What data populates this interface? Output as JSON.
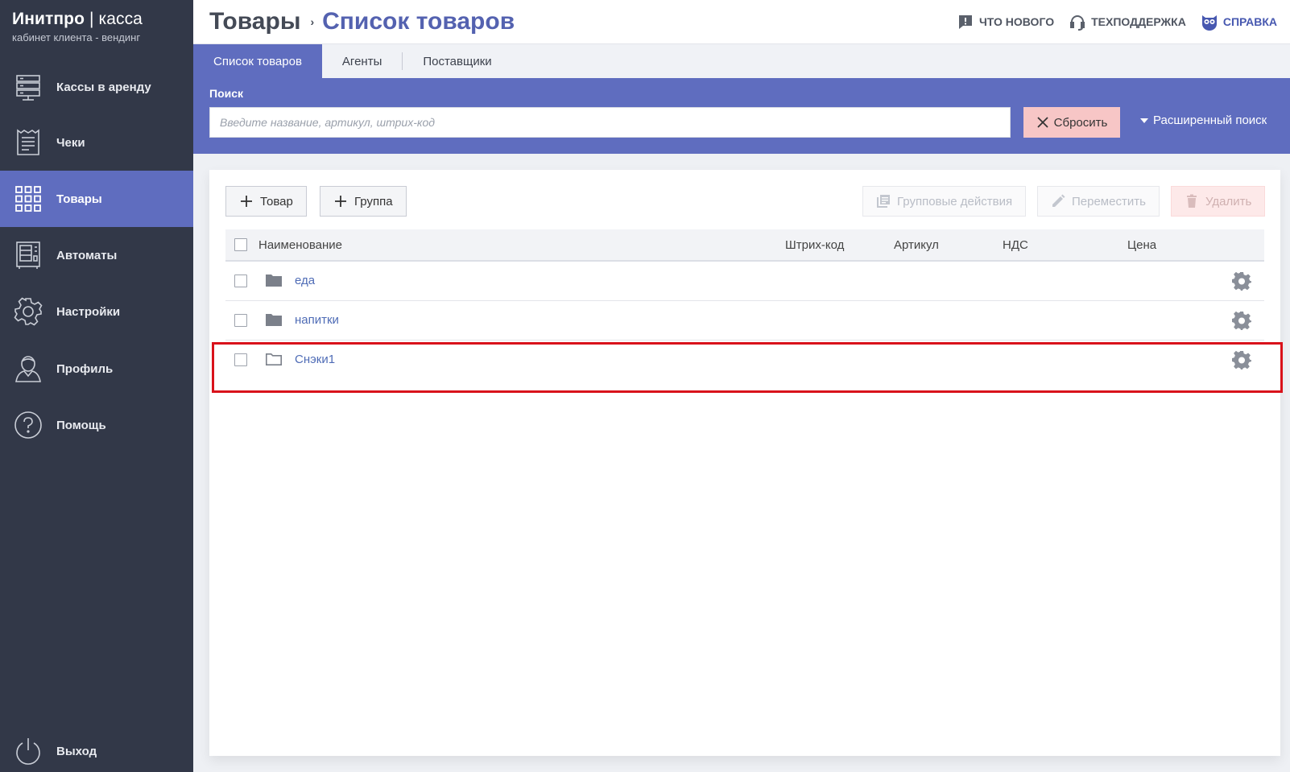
{
  "brand": {
    "name_bold": "Инитпро",
    "name_sep": " | ",
    "name_thin": "касса",
    "subtitle": "кабинет клиента - вендинг"
  },
  "sidebar": {
    "items": [
      {
        "label": "Кассы в аренду",
        "icon": "server-rack-icon",
        "active": false
      },
      {
        "label": "Чеки",
        "icon": "receipt-icon",
        "active": false
      },
      {
        "label": "Товары",
        "icon": "grid-icon",
        "active": true
      },
      {
        "label": "Автоматы",
        "icon": "vending-machine-icon",
        "active": false
      },
      {
        "label": "Настройки",
        "icon": "gear-icon",
        "active": false
      },
      {
        "label": "Профиль",
        "icon": "user-icon",
        "active": false
      },
      {
        "label": "Помощь",
        "icon": "question-icon",
        "active": false
      }
    ],
    "logout": {
      "label": "Выход",
      "icon": "power-icon"
    }
  },
  "header": {
    "breadcrumb_root": "Товары",
    "breadcrumb_sep": "›",
    "breadcrumb_current": "Список товаров",
    "links": {
      "whats_new": "ЧТО НОВОГО",
      "support": "ТЕХПОДДЕРЖКА",
      "help": "СПРАВКА"
    }
  },
  "tabs": [
    {
      "label": "Список товаров",
      "active": true
    },
    {
      "label": "Агенты",
      "active": false
    },
    {
      "label": "Поставщики",
      "active": false
    }
  ],
  "search": {
    "label": "Поиск",
    "value": "",
    "placeholder": "Введите название, артикул, штрих-код",
    "reset_label": "Сбросить",
    "advanced_label": "Расширенный поиск"
  },
  "toolbar": {
    "add_product": "Товар",
    "add_group": "Группа",
    "group_actions": "Групповые действия",
    "move": "Переместить",
    "delete": "Удалить"
  },
  "table": {
    "columns": {
      "name": "Наименование",
      "barcode": "Штрих-код",
      "article": "Артикул",
      "vat": "НДС",
      "price": "Цена"
    },
    "rows": [
      {
        "name": "еда",
        "type": "folder-filled"
      },
      {
        "name": "напитки",
        "type": "folder-filled"
      },
      {
        "name": "Снэки1",
        "type": "folder-outline"
      }
    ]
  },
  "colors": {
    "sidebar_bg": "#323848",
    "accent": "#5f6dbf",
    "link": "#4f6cb6",
    "reset_bg": "#f7c6c6",
    "highlight": "#d9121b"
  }
}
